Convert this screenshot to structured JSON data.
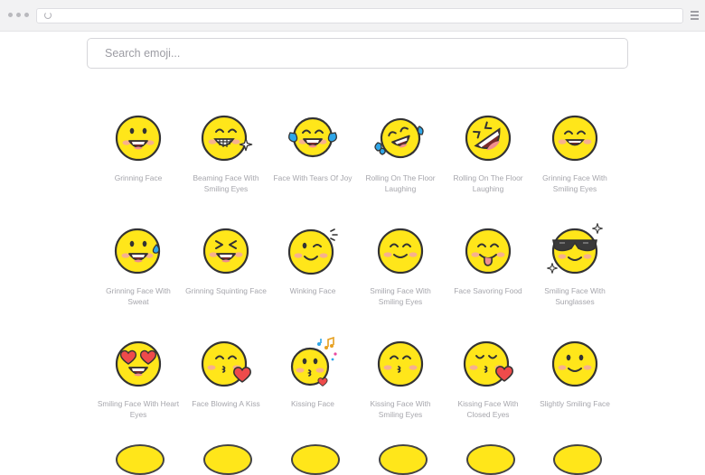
{
  "search": {
    "placeholder": "Search emoji..."
  },
  "emojis": [
    {
      "label": "Grinning Face",
      "icon": "grinning-face-icon"
    },
    {
      "label": "Beaming Face With Smiling Eyes",
      "icon": "beaming-face-icon"
    },
    {
      "label": "Face With Tears Of Joy",
      "icon": "tears-of-joy-icon"
    },
    {
      "label": "Rolling On The Floor Laughing",
      "icon": "rolling-laughing-icon"
    },
    {
      "label": "Rolling On The Floor Laughing",
      "icon": "rolling-laughing-alt-icon"
    },
    {
      "label": "Grinning Face With Smiling Eyes",
      "icon": "grinning-smiling-eyes-icon"
    },
    {
      "label": "Grinning Face With Sweat",
      "icon": "grinning-sweat-icon"
    },
    {
      "label": "Grinning Squinting Face",
      "icon": "grinning-squinting-icon"
    },
    {
      "label": "Winking Face",
      "icon": "winking-face-icon"
    },
    {
      "label": "Smiling Face With Smiling Eyes",
      "icon": "smiling-eyes-icon"
    },
    {
      "label": "Face Savoring Food",
      "icon": "savoring-food-icon"
    },
    {
      "label": "Smiling Face With Sunglasses",
      "icon": "sunglasses-face-icon"
    },
    {
      "label": "Smiling Face With Heart Eyes",
      "icon": "heart-eyes-icon"
    },
    {
      "label": "Face Blowing A Kiss",
      "icon": "blowing-kiss-icon"
    },
    {
      "label": "Kissing Face",
      "icon": "kissing-face-icon"
    },
    {
      "label": "Kissing Face With Smiling Eyes",
      "icon": "kissing-smiling-eyes-icon"
    },
    {
      "label": "Kissing Face With Closed Eyes",
      "icon": "kissing-closed-eyes-icon"
    },
    {
      "label": "Slightly Smiling Face",
      "icon": "slightly-smiling-icon"
    }
  ],
  "colors": {
    "face": "#FFE61A",
    "outline": "#333333",
    "blush": "#F6A7A2",
    "tear": "#2FA6E8",
    "heart": "#EE4B4B"
  }
}
